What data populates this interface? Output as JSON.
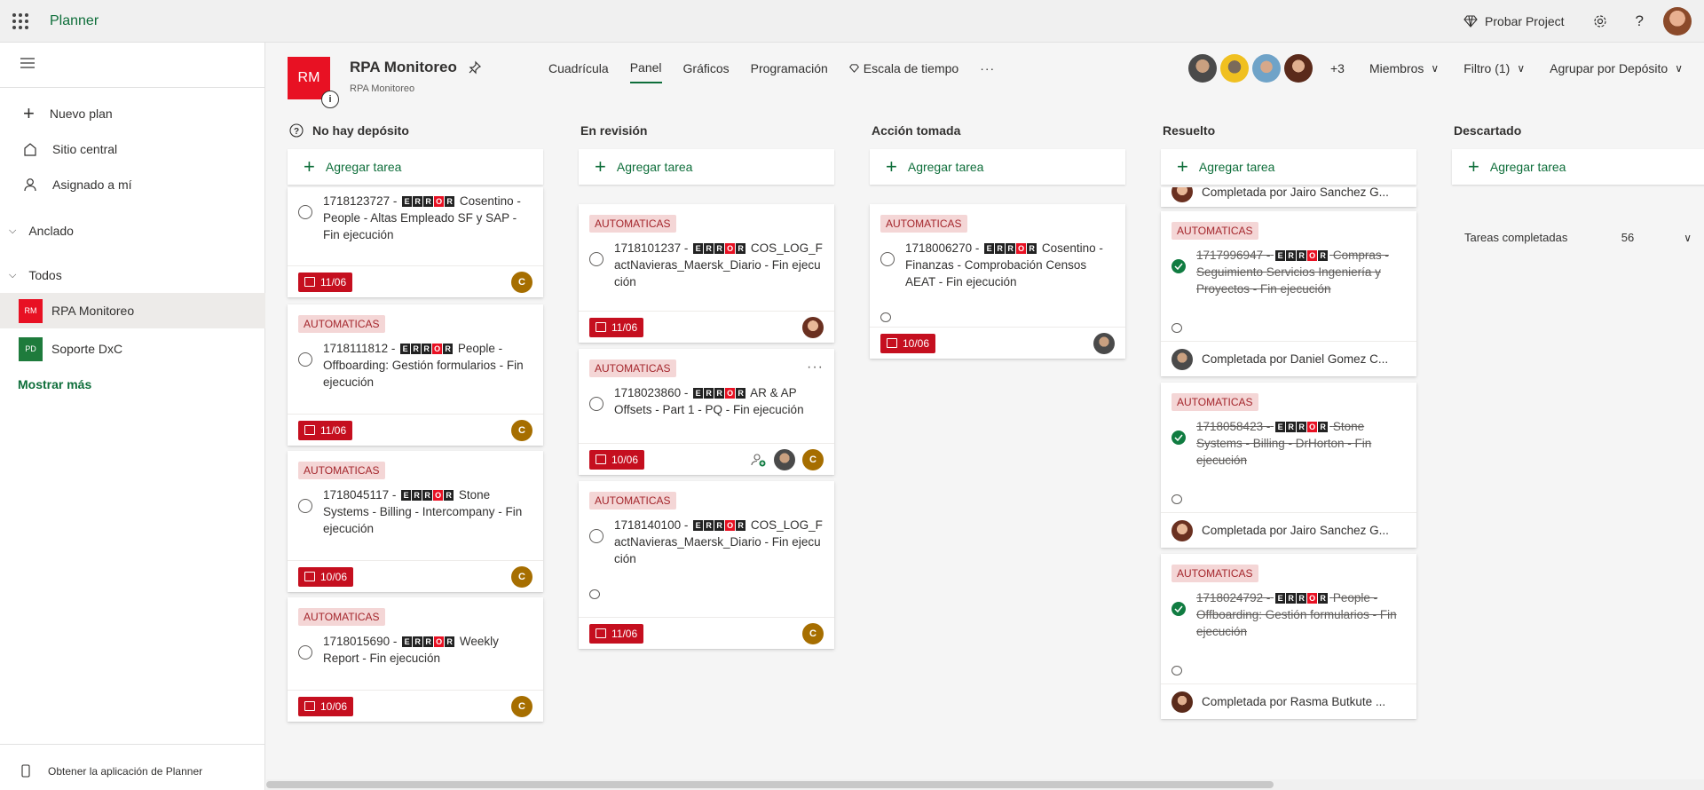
{
  "app": {
    "name": "Planner"
  },
  "topbar": {
    "try_project": "Probar Project"
  },
  "sidebar": {
    "new_plan": "Nuevo plan",
    "hub": "Sitio central",
    "assigned": "Asignado a mí",
    "pinned": "Anclado",
    "all": "Todos",
    "plans": [
      {
        "initials": "RM",
        "name": "RPA Monitoreo",
        "color": "#e81123"
      },
      {
        "initials": "PD",
        "name": "Soporte DxC",
        "color": "#1e7b3c"
      }
    ],
    "show_more": "Mostrar más",
    "footer": "Obtener la aplicación de Planner"
  },
  "plan": {
    "initials": "RM",
    "title": "RPA Monitoreo",
    "subtitle": "RPA Monitoreo",
    "tabs": [
      "Cuadrícula",
      "Panel",
      "Gráficos",
      "Programación",
      "Escala de tiempo"
    ],
    "extra_members": "+3",
    "members_label": "Miembros",
    "filter_label": "Filtro (1)",
    "group_label": "Agrupar por Depósito"
  },
  "add_task": "Agregar tarea",
  "error_letters": [
    "E",
    "R",
    "R",
    "O",
    "R"
  ],
  "columns": [
    {
      "title": "No hay depósito"
    },
    {
      "title": "En revisión"
    },
    {
      "title": "Acción tomada"
    },
    {
      "title": "Resuelto"
    },
    {
      "title": "Descartado"
    }
  ],
  "cards": {
    "c1": {
      "pre": "1718123727 -",
      "post": "Cosentino - People - Altas Empleado SF y SAP - Fin ejecución",
      "due": "11/06",
      "user": "C"
    },
    "c2": {
      "label": "AUTOMATICAS",
      "pre": "1718111812 -",
      "post": "People - Offboarding: Gestión formularios - Fin ejecución",
      "due": "11/06",
      "user": "C"
    },
    "c3": {
      "label": "AUTOMATICAS",
      "pre": "1718045117 -",
      "post": "Stone Systems - Billing - Intercompany - Fin ejecución",
      "due": "10/06",
      "user": "C"
    },
    "c4": {
      "label": "AUTOMATICAS",
      "pre": "1718015690 -",
      "post": "Weekly Report - Fin ejecución",
      "due": "10/06",
      "user": "C"
    },
    "r1": {
      "label": "AUTOMATICAS",
      "pre": "1718101237 -",
      "post": "COS_LOG_FactNavieras_Maersk_Diario - Fin ejecución",
      "due": "11/06"
    },
    "r2": {
      "label": "AUTOMATICAS",
      "pre": "1718023860 -",
      "post": "AR & AP Offsets - Part 1 - PQ - Fin ejecución",
      "due": "10/06",
      "user": "C"
    },
    "r3": {
      "label": "AUTOMATICAS",
      "pre": "1718140100 -",
      "post": "COS_LOG_FactNavieras_Maersk_Diario - Fin ejecución",
      "due": "11/06",
      "user": "C"
    },
    "a1": {
      "label": "AUTOMATICAS",
      "pre": "1718006270 -",
      "post": "Cosentino - Finanzas - Comprobación Censos AEAT - Fin ejecución",
      "due": "10/06"
    },
    "s0": {
      "completed": "Completada por Jairo Sanchez G..."
    },
    "s1": {
      "label": "AUTOMATICAS",
      "pre": "1717996947 -",
      "post": "Compras - Seguimiento Servicios Ingeniería y Proyectos - Fin ejecución",
      "completed": "Completada por Daniel Gomez C..."
    },
    "s2": {
      "label": "AUTOMATICAS",
      "pre": "1718058423 -",
      "post": "Stone Systems - Billing - DrHorton - Fin ejecución",
      "completed": "Completada por Jairo Sanchez G..."
    },
    "s3": {
      "label": "AUTOMATICAS",
      "pre": "1718024792 -",
      "post": "People - Offboarding: Gestión formularios - Fin ejecución",
      "completed": "Completada por Rasma Butkute ..."
    }
  },
  "completed_tasks": {
    "label": "Tareas completadas",
    "count": "56"
  }
}
